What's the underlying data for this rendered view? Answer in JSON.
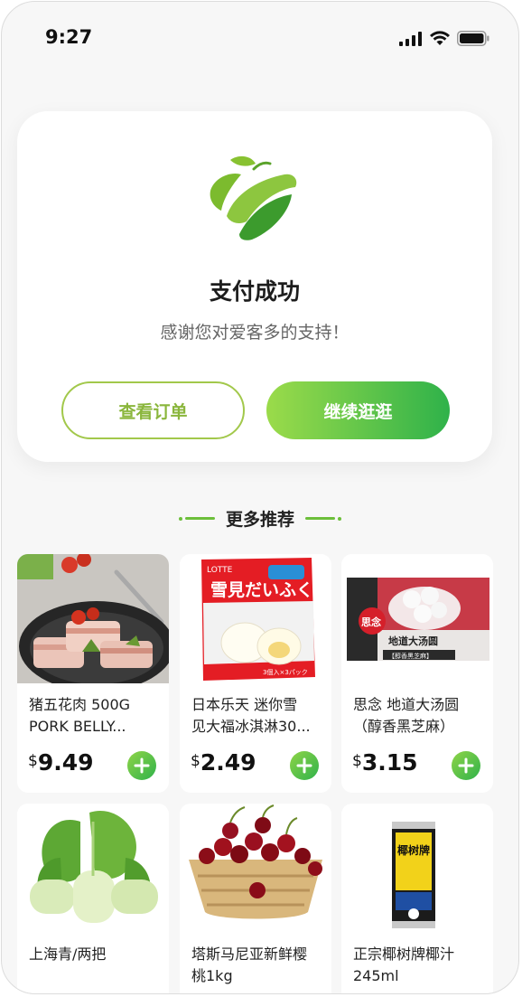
{
  "status_bar": {
    "time": "9:27"
  },
  "success": {
    "title": "支付成功",
    "subtitle": "感谢您对爱客多的支持！",
    "view_order_label": "查看订单",
    "continue_label": "继续逛逛"
  },
  "recommend": {
    "title": "更多推荐",
    "products": [
      {
        "name": "猪五花肉 500G\nPORK BELLY...",
        "currency": "$",
        "price": "9.49"
      },
      {
        "name": "日本乐天 迷你雪\n见大福冰淇淋30...",
        "currency": "$",
        "price": "2.49"
      },
      {
        "name": "思念 地道大汤圆\n（醇香黑芝麻）",
        "currency": "$",
        "price": "3.15"
      },
      {
        "name": "上海青/两把"
      },
      {
        "name": "塔斯马尼亚新鲜樱\n桃1kg"
      },
      {
        "name": "正宗椰树牌椰汁\n245ml"
      }
    ],
    "package_text": {
      "lotte_brand": "LOTTE",
      "lotte_title": "雪見だいふく",
      "lotte_count": "3個入×3パック",
      "siniang_brand": "思念",
      "siniang_title": "地道大汤圆",
      "siniang_flavor": "【醇香黑芝麻】",
      "coconut_brand": "椰树牌"
    }
  },
  "colors": {
    "brand_green": "#2fb24a",
    "light_green": "#9bdb4a",
    "outline_green": "#a2c84b"
  }
}
